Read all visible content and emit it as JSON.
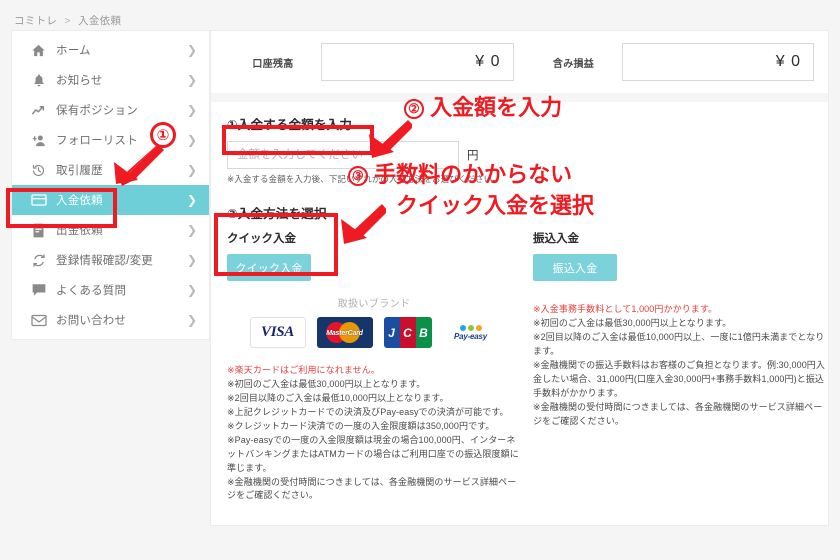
{
  "breadcrumb": {
    "root": "コミトレ",
    "separator": ">",
    "current": "入金依頼"
  },
  "sidebar": {
    "items": [
      {
        "label": "ホーム",
        "icon": "home-icon",
        "active": false
      },
      {
        "label": "お知らせ",
        "icon": "bell-icon",
        "active": false
      },
      {
        "label": "保有ポジション",
        "icon": "trend-icon",
        "active": false
      },
      {
        "label": "フォローリスト",
        "icon": "add-user-icon",
        "active": false
      },
      {
        "label": "取引履歴",
        "icon": "history-icon",
        "active": false
      },
      {
        "label": "入金依頼",
        "icon": "card-icon",
        "active": true
      },
      {
        "label": "出金依頼",
        "icon": "document-icon",
        "active": false
      },
      {
        "label": "登録情報確認/変更",
        "icon": "refresh-icon",
        "active": false
      },
      {
        "label": "よくある質問",
        "icon": "chat-icon",
        "active": false
      },
      {
        "label": "お問い合わせ",
        "icon": "mail-icon",
        "active": false
      }
    ],
    "chevron": "❯"
  },
  "balances": [
    {
      "label": "口座残高",
      "value": "¥ 0"
    },
    {
      "label": "含み損益",
      "value": "¥ 0"
    }
  ],
  "amount_section": {
    "title": "①入金する金額を入力",
    "placeholder": "金額を入力してください",
    "value": "",
    "unit": "円",
    "note": "※入金する金額を入力後、下記いずれかの入金方法をお選びください。"
  },
  "method_section": {
    "title": "②入金方法を選択",
    "quick": {
      "heading": "クイック入金",
      "button": "クイック入金",
      "brands_label": "取扱いブランド",
      "brands": [
        "VISA",
        "MasterCard",
        "JCB",
        "Pay-easy"
      ],
      "notes": [
        {
          "text": "※楽天カードはご利用になれません。",
          "red": true
        },
        {
          "text": "※初回のご入金は最低30,000円以上となります。",
          "red": false
        },
        {
          "text": "※2回目以降のご入金は最低10,000円以上となります。",
          "red": false
        },
        {
          "text": "※上記クレジットカードでの決済及びPay-easyでの決済が可能です。",
          "red": false
        },
        {
          "text": "※クレジットカード決済での一度の入金限度額は350,000円です。",
          "red": false
        },
        {
          "text": "※Pay-easyでの一度の入金限度額は現金の場合100,000円、インターネットバンキングまたはATMカードの場合はご利用口座での振込限度額に準じます。",
          "red": false
        },
        {
          "text": "※金融機関の受付時間につきましては、各金融機関のサービス詳細ページをご確認ください。",
          "red": false
        }
      ]
    },
    "bank": {
      "heading": "振込入金",
      "button": "振込入金",
      "notes": [
        {
          "text": "※入金事務手数料として1,000円かかります。",
          "red": true
        },
        {
          "text": "※初回のご入金は最低30,000円以上となります。",
          "red": false
        },
        {
          "text": "※2回目以降のご入金は最低10,000円以上、一度に1億円未満までとなります。",
          "red": false
        },
        {
          "text": "※金融機関での振込手数料はお客様のご負担となります。例:30,000円入金したい場合、31,000円(口座入金30,000円+事務手数料1,000円)と振込手数料がかかります。",
          "red": false
        },
        {
          "text": "※金融機関の受付時間につきましては、各金融機関のサービス詳細ページをご確認ください。",
          "red": false
        }
      ]
    }
  },
  "annotations": {
    "step1": {
      "number": "①"
    },
    "step2": {
      "number": "②",
      "text": "入金額を入力"
    },
    "step3": {
      "number": "③",
      "line1": "手数料のかからない",
      "line2": "クイック入金を選択"
    },
    "accent_color": "#ee1c22"
  }
}
